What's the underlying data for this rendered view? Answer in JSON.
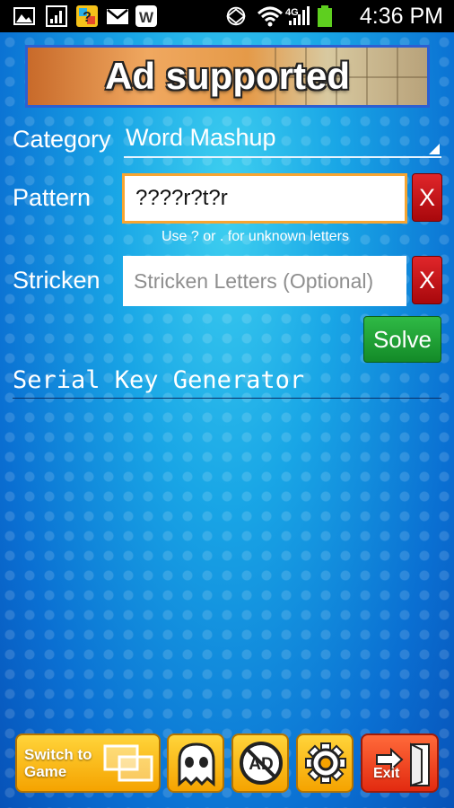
{
  "status_bar": {
    "time": "4:36 PM"
  },
  "ad_banner": {
    "text": "Ad supported"
  },
  "form": {
    "category_label": "Category",
    "category_value": "Word Mashup",
    "pattern_label": "Pattern",
    "pattern_value": "????r?t?r",
    "pattern_clear_label": "X",
    "hint": "Use ? or . for unknown letters",
    "stricken_label": "Stricken",
    "stricken_placeholder": "Stricken Letters (Optional)",
    "stricken_clear_label": "X",
    "solve_label": "Solve"
  },
  "result": {
    "title": "Serial Key Generator"
  },
  "toolbar": {
    "switch_label": "Switch to Game",
    "exit_label": "Exit",
    "icons": [
      "ghost-icon",
      "no-ads-icon",
      "gear-icon",
      "exit-door-icon"
    ]
  },
  "colors": {
    "pattern_border": "#f7a531",
    "clear_button": "#d1161a",
    "solve_button": "#1fa236",
    "toolbar_yellow": "#f9c01a",
    "exit_red": "#f04420"
  }
}
